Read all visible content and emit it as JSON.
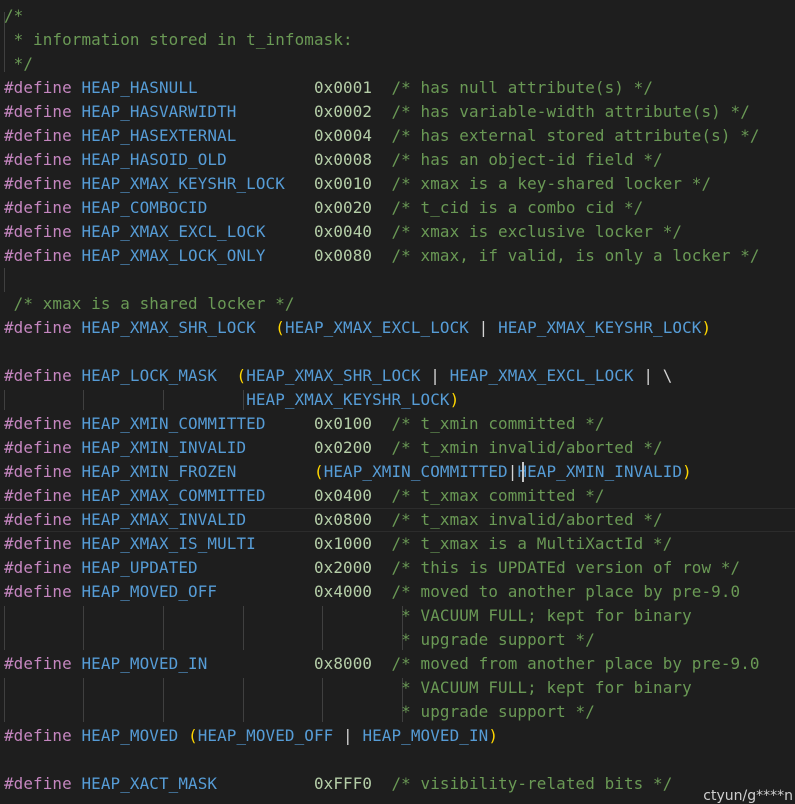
{
  "lines": [
    {
      "segments": [
        {
          "t": "/*",
          "c": "c"
        }
      ]
    },
    {
      "segments": [
        {
          "t": " * information stored in t_infomask:",
          "c": "c"
        }
      ]
    },
    {
      "segments": [
        {
          "t": " */",
          "c": "c"
        }
      ]
    },
    {
      "segments": [
        {
          "t": "#define ",
          "c": "pp"
        },
        {
          "t": "HEAP_HASNULL",
          "c": "mc"
        },
        {
          "t": "            ",
          "c": "op"
        },
        {
          "t": "0x0001",
          "c": "hx"
        },
        {
          "t": "  ",
          "c": "op"
        },
        {
          "t": "/* has null attribute(s) */",
          "c": "c"
        }
      ]
    },
    {
      "segments": [
        {
          "t": "#define ",
          "c": "pp"
        },
        {
          "t": "HEAP_HASVARWIDTH",
          "c": "mc"
        },
        {
          "t": "        ",
          "c": "op"
        },
        {
          "t": "0x0002",
          "c": "hx"
        },
        {
          "t": "  ",
          "c": "op"
        },
        {
          "t": "/* has variable-width attribute(s) */",
          "c": "c"
        }
      ]
    },
    {
      "segments": [
        {
          "t": "#define ",
          "c": "pp"
        },
        {
          "t": "HEAP_HASEXTERNAL",
          "c": "mc"
        },
        {
          "t": "        ",
          "c": "op"
        },
        {
          "t": "0x0004",
          "c": "hx"
        },
        {
          "t": "  ",
          "c": "op"
        },
        {
          "t": "/* has external stored attribute(s) */",
          "c": "c"
        }
      ]
    },
    {
      "segments": [
        {
          "t": "#define ",
          "c": "pp"
        },
        {
          "t": "HEAP_HASOID_OLD",
          "c": "mc"
        },
        {
          "t": "         ",
          "c": "op"
        },
        {
          "t": "0x0008",
          "c": "hx"
        },
        {
          "t": "  ",
          "c": "op"
        },
        {
          "t": "/* has an object-id field */",
          "c": "c"
        }
      ]
    },
    {
      "segments": [
        {
          "t": "#define ",
          "c": "pp"
        },
        {
          "t": "HEAP_XMAX_KEYSHR_LOCK",
          "c": "mc"
        },
        {
          "t": "   ",
          "c": "op"
        },
        {
          "t": "0x0010",
          "c": "hx"
        },
        {
          "t": "  ",
          "c": "op"
        },
        {
          "t": "/* xmax is a key-shared locker */",
          "c": "c"
        }
      ]
    },
    {
      "segments": [
        {
          "t": "#define ",
          "c": "pp"
        },
        {
          "t": "HEAP_COMBOCID",
          "c": "mc"
        },
        {
          "t": "           ",
          "c": "op"
        },
        {
          "t": "0x0020",
          "c": "hx"
        },
        {
          "t": "  ",
          "c": "op"
        },
        {
          "t": "/* t_cid is a combo cid */",
          "c": "c"
        }
      ]
    },
    {
      "segments": [
        {
          "t": "#define ",
          "c": "pp"
        },
        {
          "t": "HEAP_XMAX_EXCL_LOCK",
          "c": "mc"
        },
        {
          "t": "     ",
          "c": "op"
        },
        {
          "t": "0x0040",
          "c": "hx"
        },
        {
          "t": "  ",
          "c": "op"
        },
        {
          "t": "/* xmax is exclusive locker */",
          "c": "c"
        }
      ]
    },
    {
      "segments": [
        {
          "t": "#define ",
          "c": "pp"
        },
        {
          "t": "HEAP_XMAX_LOCK_ONLY",
          "c": "mc"
        },
        {
          "t": "     ",
          "c": "op"
        },
        {
          "t": "0x0080",
          "c": "hx"
        },
        {
          "t": "  ",
          "c": "op"
        },
        {
          "t": "/* xmax, if valid, is only a locker */",
          "c": "c"
        }
      ]
    },
    {
      "segments": []
    },
    {
      "segments": [
        {
          "t": " /* xmax is a shared locker */",
          "c": "c"
        }
      ]
    },
    {
      "segments": [
        {
          "t": "#define ",
          "c": "pp"
        },
        {
          "t": "HEAP_XMAX_SHR_LOCK",
          "c": "mc"
        },
        {
          "t": "  ",
          "c": "op"
        },
        {
          "t": "(",
          "c": "pn"
        },
        {
          "t": "HEAP_XMAX_EXCL_LOCK",
          "c": "mc"
        },
        {
          "t": " | ",
          "c": "op"
        },
        {
          "t": "HEAP_XMAX_KEYSHR_LOCK",
          "c": "mc"
        },
        {
          "t": ")",
          "c": "pn"
        }
      ]
    },
    {
      "segments": []
    },
    {
      "segments": [
        {
          "t": "#define ",
          "c": "pp"
        },
        {
          "t": "HEAP_LOCK_MASK",
          "c": "mc"
        },
        {
          "t": "  ",
          "c": "op"
        },
        {
          "t": "(",
          "c": "pn"
        },
        {
          "t": "HEAP_XMAX_SHR_LOCK",
          "c": "mc"
        },
        {
          "t": " | ",
          "c": "op"
        },
        {
          "t": "HEAP_XMAX_EXCL_LOCK",
          "c": "mc"
        },
        {
          "t": " | \\",
          "c": "op"
        }
      ]
    },
    {
      "segments": [
        {
          "t": "                         ",
          "c": "op"
        },
        {
          "t": "HEAP_XMAX_KEYSHR_LOCK",
          "c": "mc"
        },
        {
          "t": ")",
          "c": "pn"
        }
      ]
    },
    {
      "segments": [
        {
          "t": "#define ",
          "c": "pp"
        },
        {
          "t": "HEAP_XMIN_COMMITTED",
          "c": "mc"
        },
        {
          "t": "     ",
          "c": "op"
        },
        {
          "t": "0x0100",
          "c": "hx"
        },
        {
          "t": "  ",
          "c": "op"
        },
        {
          "t": "/* t_xmin committed */",
          "c": "c"
        }
      ]
    },
    {
      "segments": [
        {
          "t": "#define ",
          "c": "pp"
        },
        {
          "t": "HEAP_XMIN_INVALID",
          "c": "mc"
        },
        {
          "t": "       ",
          "c": "op"
        },
        {
          "t": "0x0200",
          "c": "hx"
        },
        {
          "t": "  ",
          "c": "op"
        },
        {
          "t": "/* t_xmin invalid/aborted */",
          "c": "c"
        }
      ]
    },
    {
      "segments": [
        {
          "t": "#define ",
          "c": "pp"
        },
        {
          "t": "HEAP_XMIN_FROZEN",
          "c": "mc"
        },
        {
          "t": "        ",
          "c": "op"
        },
        {
          "t": "(",
          "c": "pn"
        },
        {
          "t": "HEAP_XMIN_COMMITTED",
          "c": "mc"
        },
        {
          "t": "|",
          "c": "op"
        },
        {
          "t": "HEAP_XMIN_INVALID",
          "c": "mc"
        },
        {
          "t": ")",
          "c": "pn"
        }
      ]
    },
    {
      "segments": [
        {
          "t": "#define ",
          "c": "pp"
        },
        {
          "t": "HEAP_XMAX_COMMITTED",
          "c": "mc"
        },
        {
          "t": "     ",
          "c": "op"
        },
        {
          "t": "0x0400",
          "c": "hx"
        },
        {
          "t": "  ",
          "c": "op"
        },
        {
          "t": "/* t_xmax committed */",
          "c": "c"
        }
      ]
    },
    {
      "segments": [
        {
          "t": "#define ",
          "c": "pp"
        },
        {
          "t": "HEAP_XMAX_INVALID",
          "c": "mc"
        },
        {
          "t": "       ",
          "c": "op"
        },
        {
          "t": "0x0800",
          "c": "hx"
        },
        {
          "t": "  ",
          "c": "op"
        },
        {
          "t": "/* t_xmax invalid/aborted */",
          "c": "c"
        }
      ]
    },
    {
      "segments": [
        {
          "t": "#define ",
          "c": "pp"
        },
        {
          "t": "HEAP_XMAX_IS_MULTI",
          "c": "mc"
        },
        {
          "t": "      ",
          "c": "op"
        },
        {
          "t": "0x1000",
          "c": "hx"
        },
        {
          "t": "  ",
          "c": "op"
        },
        {
          "t": "/* t_xmax is a MultiXactId */",
          "c": "c"
        }
      ]
    },
    {
      "segments": [
        {
          "t": "#define ",
          "c": "pp"
        },
        {
          "t": "HEAP_UPDATED",
          "c": "mc"
        },
        {
          "t": "            ",
          "c": "op"
        },
        {
          "t": "0x2000",
          "c": "hx"
        },
        {
          "t": "  ",
          "c": "op"
        },
        {
          "t": "/* this is UPDATEd version of row */",
          "c": "c"
        }
      ]
    },
    {
      "segments": [
        {
          "t": "#define ",
          "c": "pp"
        },
        {
          "t": "HEAP_MOVED_OFF",
          "c": "mc"
        },
        {
          "t": "          ",
          "c": "op"
        },
        {
          "t": "0x4000",
          "c": "hx"
        },
        {
          "t": "  ",
          "c": "op"
        },
        {
          "t": "/* moved to another place by pre-9.0",
          "c": "c"
        }
      ]
    },
    {
      "segments": [
        {
          "t": "                                         ",
          "c": "op"
        },
        {
          "t": "* VACUUM FULL; kept for binary",
          "c": "c"
        }
      ]
    },
    {
      "segments": [
        {
          "t": "                                         ",
          "c": "op"
        },
        {
          "t": "* upgrade support */",
          "c": "c"
        }
      ]
    },
    {
      "segments": [
        {
          "t": "#define ",
          "c": "pp"
        },
        {
          "t": "HEAP_MOVED_IN",
          "c": "mc"
        },
        {
          "t": "           ",
          "c": "op"
        },
        {
          "t": "0x8000",
          "c": "hx"
        },
        {
          "t": "  ",
          "c": "op"
        },
        {
          "t": "/* moved from another place by pre-9.0",
          "c": "c"
        }
      ]
    },
    {
      "segments": [
        {
          "t": "                                         ",
          "c": "op"
        },
        {
          "t": "* VACUUM FULL; kept for binary",
          "c": "c"
        }
      ]
    },
    {
      "segments": [
        {
          "t": "                                         ",
          "c": "op"
        },
        {
          "t": "* upgrade support */",
          "c": "c"
        }
      ]
    },
    {
      "segments": [
        {
          "t": "#define ",
          "c": "pp"
        },
        {
          "t": "HEAP_MOVED",
          "c": "mc"
        },
        {
          "t": " ",
          "c": "op"
        },
        {
          "t": "(",
          "c": "pn"
        },
        {
          "t": "HEAP_MOVED_OFF",
          "c": "mc"
        },
        {
          "t": " | ",
          "c": "op"
        },
        {
          "t": "HEAP_MOVED_IN",
          "c": "mc"
        },
        {
          "t": ")",
          "c": "pn"
        }
      ]
    },
    {
      "segments": []
    },
    {
      "segments": [
        {
          "t": "#define ",
          "c": "pp"
        },
        {
          "t": "HEAP_XACT_MASK",
          "c": "mc"
        },
        {
          "t": "          ",
          "c": "op"
        },
        {
          "t": "0xFFF0",
          "c": "hx"
        },
        {
          "t": "  ",
          "c": "op"
        },
        {
          "t": "/* visibility-related bits */",
          "c": "c"
        }
      ]
    }
  ],
  "watermark": "ctyun/g****n",
  "colors": {
    "background": "#1e1e1e",
    "comment": "#6a9955",
    "preprocessor": "#c586c0",
    "macro": "#569cd6",
    "number": "#b5cea8",
    "bracket": "#ffd700",
    "text": "#d4d4d4"
  }
}
